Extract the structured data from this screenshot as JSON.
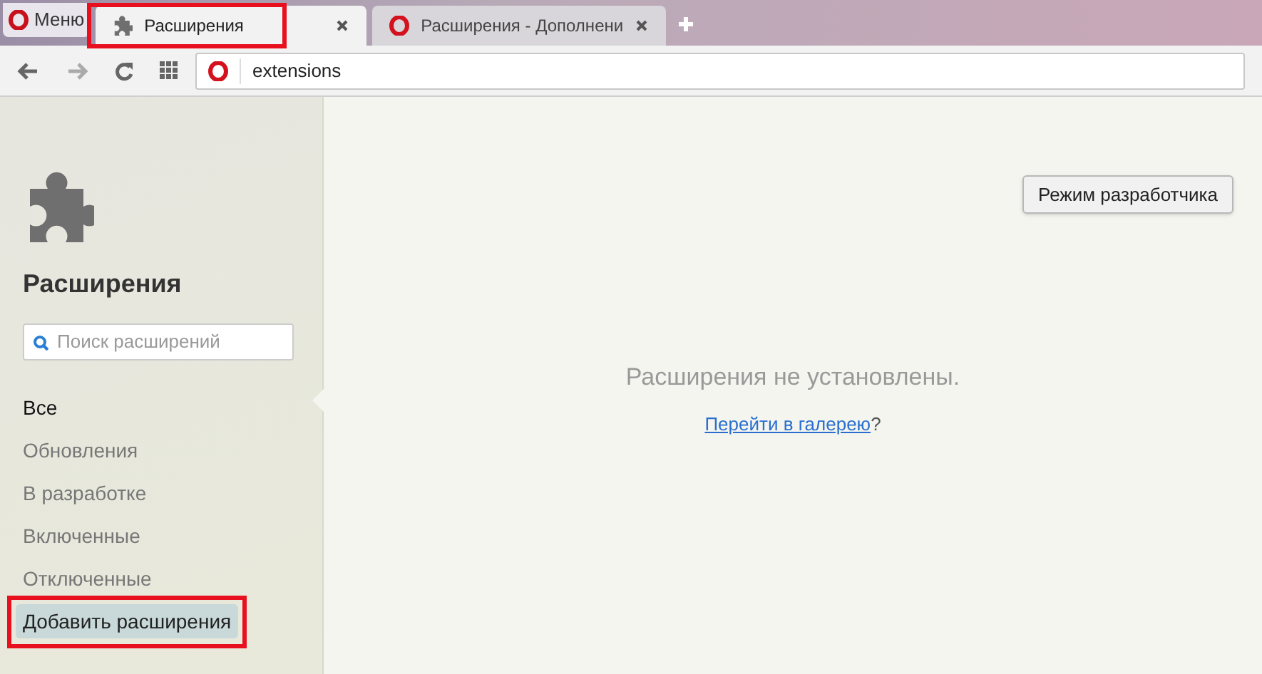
{
  "menu_button": {
    "label": "Меню"
  },
  "tabs": [
    {
      "title": "Расширения",
      "selected": true,
      "highlighted": true,
      "kind": "extensions"
    },
    {
      "title": "Расширения - Дополнени",
      "selected": false,
      "highlighted": false,
      "kind": "opera"
    }
  ],
  "address_bar": {
    "value": "extensions"
  },
  "sidebar": {
    "title": "Расширения",
    "search": {
      "placeholder": "Поиск расширений"
    },
    "items": [
      {
        "label": "Все",
        "selected": true,
        "highlighted": false
      },
      {
        "label": "Обновления",
        "selected": false,
        "highlighted": false
      },
      {
        "label": "В разработке",
        "selected": false,
        "highlighted": false
      },
      {
        "label": "Включенные",
        "selected": false,
        "highlighted": false
      },
      {
        "label": "Отключенные",
        "selected": false,
        "highlighted": false
      },
      {
        "label": "Добавить расширения",
        "selected": false,
        "highlighted": true,
        "kind": "button"
      }
    ]
  },
  "developer_mode_button": {
    "label": "Режим разработчика"
  },
  "empty_message": "Расширения не установлены.",
  "gallery_prompt": {
    "link": "Перейти в галерею",
    "suffix": "?"
  }
}
